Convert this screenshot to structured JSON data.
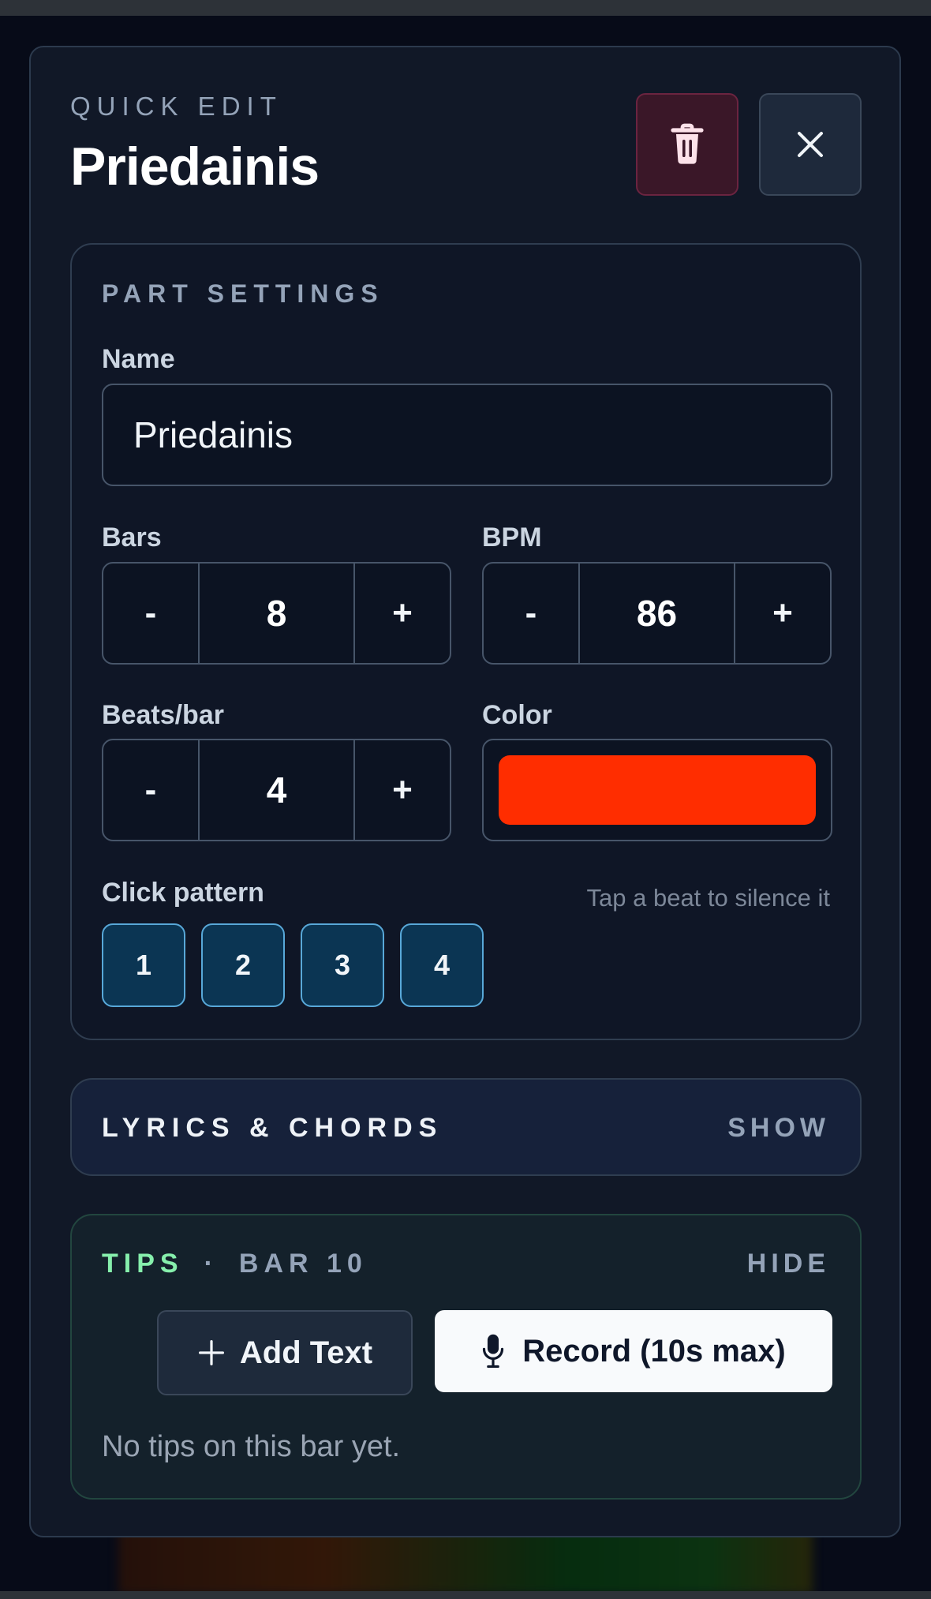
{
  "header": {
    "kicker": "QUICK EDIT",
    "title": "Priedainis",
    "delete_icon": "trash-icon",
    "close_icon": "close-icon"
  },
  "part_settings": {
    "section_label": "PART SETTINGS",
    "name": {
      "label": "Name",
      "value": "Priedainis"
    },
    "bars": {
      "label": "Bars",
      "value": "8",
      "decrement": "-",
      "increment": "+"
    },
    "bpm": {
      "label": "BPM",
      "value": "86",
      "decrement": "-",
      "increment": "+"
    },
    "beats_per_bar": {
      "label": "Beats/bar",
      "value": "4",
      "decrement": "-",
      "increment": "+"
    },
    "color": {
      "label": "Color",
      "value": "#ff2d00"
    },
    "click_pattern": {
      "label": "Click pattern",
      "hint": "Tap a beat to silence it",
      "beats": [
        "1",
        "2",
        "3",
        "4"
      ]
    }
  },
  "lyrics": {
    "section_label": "LYRICS & CHORDS",
    "toggle": "SHOW"
  },
  "tips": {
    "section_label": "TIPS",
    "separator": "·",
    "bar_label": "BAR 10",
    "toggle": "HIDE",
    "add_text_label": "Add Text",
    "add_text_icon": "plus-icon",
    "record_label": "Record (10s max)",
    "record_icon": "microphone-icon",
    "empty_message": "No tips on this bar yet."
  },
  "colors": {
    "panel_bg": "#111827",
    "accent_green": "#86efac",
    "beat_fill": "#0b3553",
    "danger_bg": "#3a1728"
  }
}
